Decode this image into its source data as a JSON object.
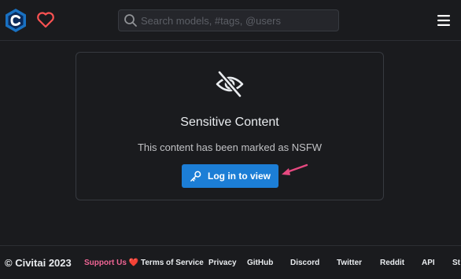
{
  "header": {
    "search_placeholder": "Search models, #tags, @users"
  },
  "card": {
    "title": "Sensitive Content",
    "message": "This content has been marked as NSFW",
    "login_label": "Log in to view"
  },
  "footer": {
    "copyright": "© Civitai 2023",
    "support": "Support Us ❤️",
    "links": [
      "Terms of Service",
      "Privacy",
      "GitHub",
      "Discord",
      "Twitter",
      "Reddit",
      "API",
      "St"
    ]
  },
  "colors": {
    "accent": "#1c7ed6",
    "logo": "#1971c2",
    "heart": "#fa5252",
    "support": "#f06595",
    "arrow": "#e64980"
  }
}
